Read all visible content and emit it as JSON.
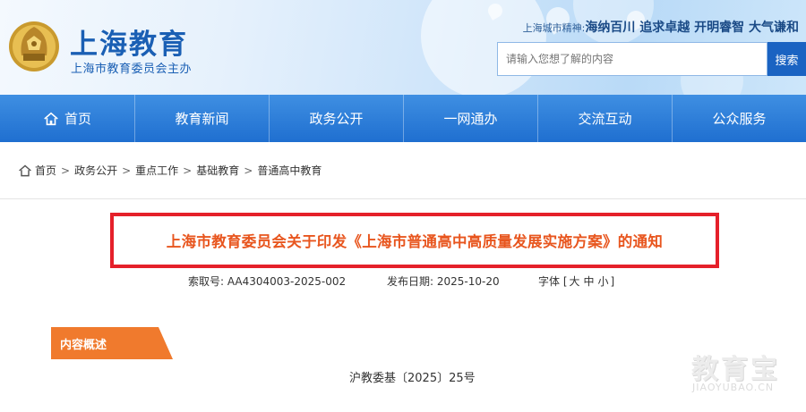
{
  "header": {
    "site_title": "上海教育",
    "site_subtitle": "上海市教育委员会主办",
    "spirit_lead": "上海城市精神:",
    "spirit_motto": "海纳百川 追求卓越 开明睿智 大气谦和",
    "search_placeholder": "请输入您想了解的内容",
    "search_button": "搜索"
  },
  "nav": {
    "items": [
      {
        "label": "首页",
        "icon": "home-icon"
      },
      {
        "label": "教育新闻"
      },
      {
        "label": "政务公开"
      },
      {
        "label": "一网通办"
      },
      {
        "label": "交流互动"
      },
      {
        "label": "公众服务"
      }
    ]
  },
  "breadcrumb": {
    "items": [
      "首页",
      "政务公开",
      "重点工作",
      "基础教育",
      "普通高中教育"
    ],
    "separator": ">"
  },
  "article": {
    "title": "上海市教育委员会关于印发《上海市普通高中高质量发展实施方案》的通知",
    "index_no": "索取号: AA4304003-2025-002",
    "publish_date": "发布日期: 2025-10-20",
    "font_label": "字体 [",
    "font_large": "大",
    "font_medium": "中",
    "font_small": "小",
    "font_close": "]",
    "summary_label": "内容概述",
    "doc_number": "沪教委基〔2025〕25号"
  },
  "watermark": {
    "main": "教育宝",
    "sub": "JIAOYUBAO.CN"
  },
  "colors": {
    "nav_blue": "#1f6fd0",
    "title_orange": "#e8561f",
    "highlight_red": "#e5202a",
    "tab_orange": "#f07a2d"
  }
}
